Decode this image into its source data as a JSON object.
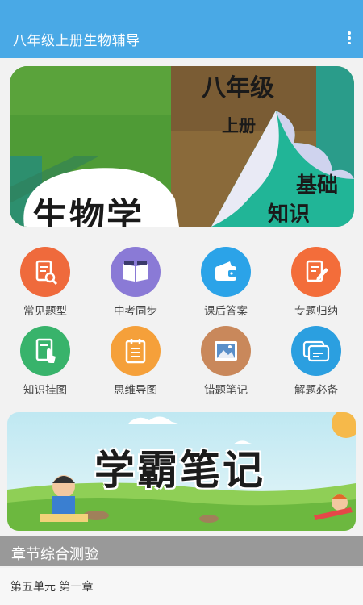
{
  "app": {
    "title": "八年级上册生物辅导"
  },
  "top_banner": {
    "grade": "八年级",
    "volume": "上册",
    "subject": "生物学",
    "tag_line1": "基础",
    "tag_line2": "知识"
  },
  "grid": [
    {
      "label": "常见题型",
      "icon": "search-document-icon",
      "color": "#ef6a3c"
    },
    {
      "label": "中考同步",
      "icon": "open-book-icon",
      "color": "#8a7ad6"
    },
    {
      "label": "课后答案",
      "icon": "wallet-icon",
      "color": "#2ba3e8"
    },
    {
      "label": "专题归纳",
      "icon": "edit-document-icon",
      "color": "#f36d3a"
    },
    {
      "label": "知识挂图",
      "icon": "tap-document-icon",
      "color": "#38b36b"
    },
    {
      "label": "思维导图",
      "icon": "notepad-icon",
      "color": "#f5a03a"
    },
    {
      "label": "错题笔记",
      "icon": "picture-icon",
      "color": "#c9885b"
    },
    {
      "label": "解题必备",
      "icon": "cards-icon",
      "color": "#2b9fe0"
    }
  ],
  "promo_banner": {
    "title": "学霸笔记"
  },
  "section": {
    "title": "章节综合测验"
  },
  "list": [
    {
      "label": "第五单元 第一章"
    }
  ]
}
